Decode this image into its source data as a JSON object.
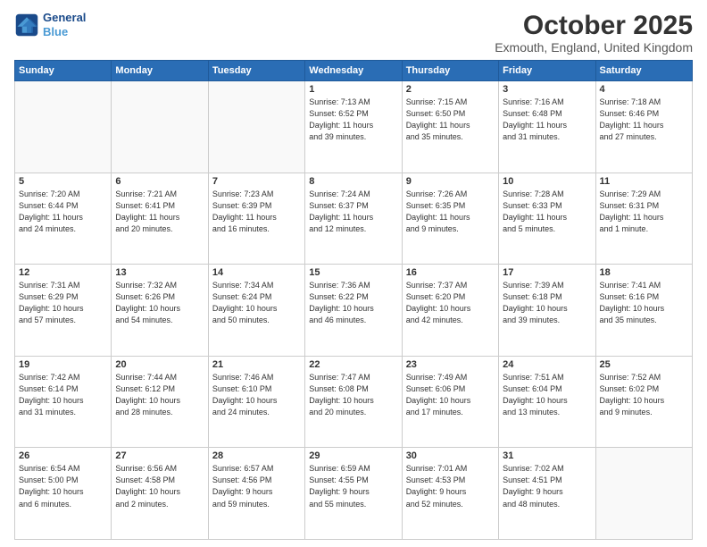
{
  "header": {
    "logo_line1": "General",
    "logo_line2": "Blue",
    "month": "October 2025",
    "location": "Exmouth, England, United Kingdom"
  },
  "weekdays": [
    "Sunday",
    "Monday",
    "Tuesday",
    "Wednesday",
    "Thursday",
    "Friday",
    "Saturday"
  ],
  "weeks": [
    [
      {
        "day": "",
        "info": ""
      },
      {
        "day": "",
        "info": ""
      },
      {
        "day": "",
        "info": ""
      },
      {
        "day": "1",
        "info": "Sunrise: 7:13 AM\nSunset: 6:52 PM\nDaylight: 11 hours\nand 39 minutes."
      },
      {
        "day": "2",
        "info": "Sunrise: 7:15 AM\nSunset: 6:50 PM\nDaylight: 11 hours\nand 35 minutes."
      },
      {
        "day": "3",
        "info": "Sunrise: 7:16 AM\nSunset: 6:48 PM\nDaylight: 11 hours\nand 31 minutes."
      },
      {
        "day": "4",
        "info": "Sunrise: 7:18 AM\nSunset: 6:46 PM\nDaylight: 11 hours\nand 27 minutes."
      }
    ],
    [
      {
        "day": "5",
        "info": "Sunrise: 7:20 AM\nSunset: 6:44 PM\nDaylight: 11 hours\nand 24 minutes."
      },
      {
        "day": "6",
        "info": "Sunrise: 7:21 AM\nSunset: 6:41 PM\nDaylight: 11 hours\nand 20 minutes."
      },
      {
        "day": "7",
        "info": "Sunrise: 7:23 AM\nSunset: 6:39 PM\nDaylight: 11 hours\nand 16 minutes."
      },
      {
        "day": "8",
        "info": "Sunrise: 7:24 AM\nSunset: 6:37 PM\nDaylight: 11 hours\nand 12 minutes."
      },
      {
        "day": "9",
        "info": "Sunrise: 7:26 AM\nSunset: 6:35 PM\nDaylight: 11 hours\nand 9 minutes."
      },
      {
        "day": "10",
        "info": "Sunrise: 7:28 AM\nSunset: 6:33 PM\nDaylight: 11 hours\nand 5 minutes."
      },
      {
        "day": "11",
        "info": "Sunrise: 7:29 AM\nSunset: 6:31 PM\nDaylight: 11 hours\nand 1 minute."
      }
    ],
    [
      {
        "day": "12",
        "info": "Sunrise: 7:31 AM\nSunset: 6:29 PM\nDaylight: 10 hours\nand 57 minutes."
      },
      {
        "day": "13",
        "info": "Sunrise: 7:32 AM\nSunset: 6:26 PM\nDaylight: 10 hours\nand 54 minutes."
      },
      {
        "day": "14",
        "info": "Sunrise: 7:34 AM\nSunset: 6:24 PM\nDaylight: 10 hours\nand 50 minutes."
      },
      {
        "day": "15",
        "info": "Sunrise: 7:36 AM\nSunset: 6:22 PM\nDaylight: 10 hours\nand 46 minutes."
      },
      {
        "day": "16",
        "info": "Sunrise: 7:37 AM\nSunset: 6:20 PM\nDaylight: 10 hours\nand 42 minutes."
      },
      {
        "day": "17",
        "info": "Sunrise: 7:39 AM\nSunset: 6:18 PM\nDaylight: 10 hours\nand 39 minutes."
      },
      {
        "day": "18",
        "info": "Sunrise: 7:41 AM\nSunset: 6:16 PM\nDaylight: 10 hours\nand 35 minutes."
      }
    ],
    [
      {
        "day": "19",
        "info": "Sunrise: 7:42 AM\nSunset: 6:14 PM\nDaylight: 10 hours\nand 31 minutes."
      },
      {
        "day": "20",
        "info": "Sunrise: 7:44 AM\nSunset: 6:12 PM\nDaylight: 10 hours\nand 28 minutes."
      },
      {
        "day": "21",
        "info": "Sunrise: 7:46 AM\nSunset: 6:10 PM\nDaylight: 10 hours\nand 24 minutes."
      },
      {
        "day": "22",
        "info": "Sunrise: 7:47 AM\nSunset: 6:08 PM\nDaylight: 10 hours\nand 20 minutes."
      },
      {
        "day": "23",
        "info": "Sunrise: 7:49 AM\nSunset: 6:06 PM\nDaylight: 10 hours\nand 17 minutes."
      },
      {
        "day": "24",
        "info": "Sunrise: 7:51 AM\nSunset: 6:04 PM\nDaylight: 10 hours\nand 13 minutes."
      },
      {
        "day": "25",
        "info": "Sunrise: 7:52 AM\nSunset: 6:02 PM\nDaylight: 10 hours\nand 9 minutes."
      }
    ],
    [
      {
        "day": "26",
        "info": "Sunrise: 6:54 AM\nSunset: 5:00 PM\nDaylight: 10 hours\nand 6 minutes."
      },
      {
        "day": "27",
        "info": "Sunrise: 6:56 AM\nSunset: 4:58 PM\nDaylight: 10 hours\nand 2 minutes."
      },
      {
        "day": "28",
        "info": "Sunrise: 6:57 AM\nSunset: 4:56 PM\nDaylight: 9 hours\nand 59 minutes."
      },
      {
        "day": "29",
        "info": "Sunrise: 6:59 AM\nSunset: 4:55 PM\nDaylight: 9 hours\nand 55 minutes."
      },
      {
        "day": "30",
        "info": "Sunrise: 7:01 AM\nSunset: 4:53 PM\nDaylight: 9 hours\nand 52 minutes."
      },
      {
        "day": "31",
        "info": "Sunrise: 7:02 AM\nSunset: 4:51 PM\nDaylight: 9 hours\nand 48 minutes."
      },
      {
        "day": "",
        "info": ""
      }
    ]
  ]
}
